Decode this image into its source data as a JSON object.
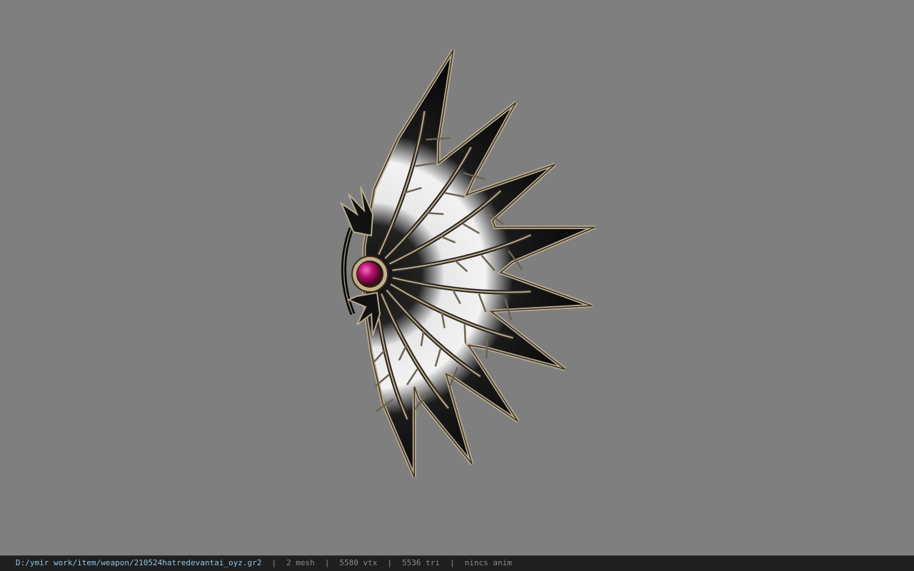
{
  "viewer": {
    "background_color": "#7f7f7f",
    "model_icon": "spiked-fan-weapon-icon",
    "gem_color": "#a0105a",
    "frame_color": "#b7aa8f",
    "blade_color": "#ececec"
  },
  "status_bar": {
    "file_path": "D:/ymir work/item/weapon/210524hatredevantai_oyz.gr2",
    "separator": "|",
    "mesh_count": "2 mesh",
    "vertex_count": "5580 vtx",
    "triangle_count": "5536 tri",
    "anim_status": "nincs anim"
  }
}
